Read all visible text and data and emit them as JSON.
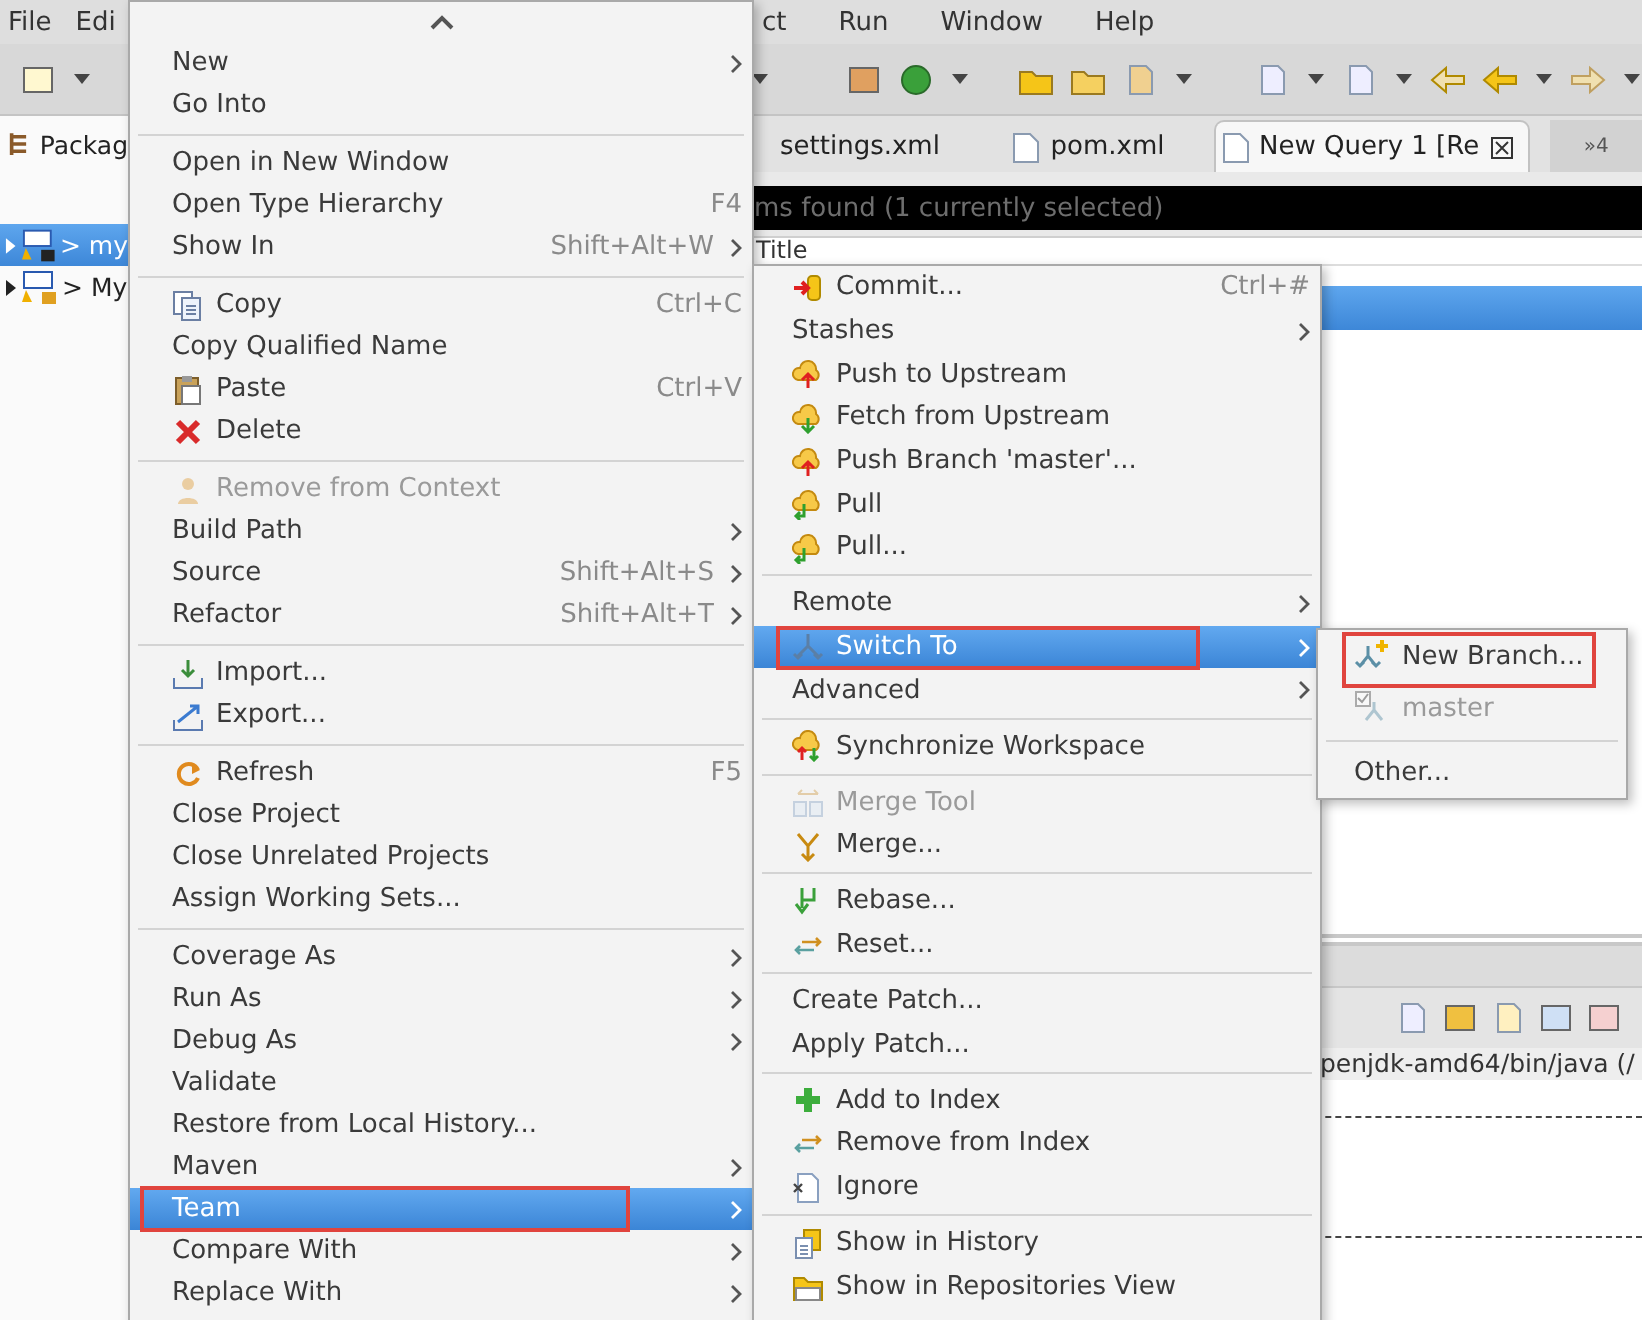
{
  "menu_bar": {
    "left": [
      "File",
      "Edi"
    ],
    "right": [
      "ct",
      "Run",
      "Window",
      "Help"
    ]
  },
  "package_explorer": {
    "tab": "Packag",
    "tree": [
      {
        "label": "> my",
        "selected": true
      },
      {
        "label": "> My",
        "selected": false
      }
    ]
  },
  "editor_tabs": [
    {
      "label": "settings.xml",
      "selected": false
    },
    {
      "label": "pom.xml",
      "selected": false
    },
    {
      "label": "New Query 1 [Re",
      "selected": true
    }
  ],
  "tab_overflow": "»4",
  "results_bar": "ms found (1 currently selected)",
  "table": {
    "column": "Title",
    "row_selected": true
  },
  "console_path": "penjdk-amd64/bin/java (/",
  "context_menu": [
    {
      "kind": "plain",
      "label": "New",
      "submenu": true,
      "selected": false,
      "disabled": false,
      "outlined": false
    },
    {
      "kind": "plain",
      "label": "Go Into",
      "selected": false,
      "disabled": false,
      "outlined": false
    },
    {
      "kind": "separator"
    },
    {
      "kind": "plain",
      "label": "Open in New Window",
      "selected": false,
      "disabled": false,
      "outlined": false
    },
    {
      "kind": "plain",
      "label": "Open Type Hierarchy",
      "shortcut": "F4",
      "selected": false,
      "disabled": false,
      "outlined": false
    },
    {
      "kind": "plain",
      "label": "Show In",
      "shortcut": "Shift+Alt+W",
      "submenu": true,
      "selected": false,
      "disabled": false,
      "outlined": false
    },
    {
      "kind": "separator"
    },
    {
      "kind": "icon",
      "label": "Copy",
      "shortcut": "Ctrl+C",
      "selected": false,
      "disabled": false,
      "outlined": false
    },
    {
      "kind": "plain",
      "label": "Copy Qualified Name",
      "selected": false,
      "disabled": false,
      "outlined": false
    },
    {
      "kind": "icon",
      "label": "Paste",
      "shortcut": "Ctrl+V",
      "selected": false,
      "disabled": false,
      "outlined": false
    },
    {
      "kind": "icon",
      "label": "Delete",
      "selected": false,
      "disabled": false,
      "outlined": false
    },
    {
      "kind": "separator"
    },
    {
      "kind": "icon",
      "label": "Remove from Context",
      "selected": false,
      "disabled": true,
      "outlined": false
    },
    {
      "kind": "plain",
      "label": "Build Path",
      "submenu": true,
      "selected": false,
      "disabled": false,
      "outlined": false
    },
    {
      "kind": "plain",
      "label": "Source",
      "shortcut": "Shift+Alt+S",
      "submenu": true,
      "selected": false,
      "disabled": false,
      "outlined": false
    },
    {
      "kind": "plain",
      "label": "Refactor",
      "shortcut": "Shift+Alt+T",
      "submenu": true,
      "selected": false,
      "disabled": false,
      "outlined": false
    },
    {
      "kind": "separator"
    },
    {
      "kind": "icon",
      "label": "Import...",
      "selected": false,
      "disabled": false,
      "outlined": false
    },
    {
      "kind": "icon",
      "label": "Export...",
      "selected": false,
      "disabled": false,
      "outlined": false
    },
    {
      "kind": "separator"
    },
    {
      "kind": "icon",
      "label": "Refresh",
      "shortcut": "F5",
      "selected": false,
      "disabled": false,
      "outlined": false
    },
    {
      "kind": "plain",
      "label": "Close Project",
      "selected": false,
      "disabled": false,
      "outlined": false
    },
    {
      "kind": "plain",
      "label": "Close Unrelated Projects",
      "selected": false,
      "disabled": false,
      "outlined": false
    },
    {
      "kind": "plain",
      "label": "Assign Working Sets...",
      "selected": false,
      "disabled": false,
      "outlined": false
    },
    {
      "kind": "separator"
    },
    {
      "kind": "plain",
      "label": "Coverage As",
      "submenu": true,
      "selected": false,
      "disabled": false,
      "outlined": false
    },
    {
      "kind": "plain",
      "label": "Run As",
      "submenu": true,
      "selected": false,
      "disabled": false,
      "outlined": false
    },
    {
      "kind": "plain",
      "label": "Debug As",
      "submenu": true,
      "selected": false,
      "disabled": false,
      "outlined": false
    },
    {
      "kind": "plain",
      "label": "Validate",
      "selected": false,
      "disabled": false,
      "outlined": false
    },
    {
      "kind": "plain",
      "label": "Restore from Local History...",
      "selected": false,
      "disabled": false,
      "outlined": false
    },
    {
      "kind": "plain",
      "label": "Maven",
      "submenu": true,
      "selected": false,
      "disabled": false,
      "outlined": false
    },
    {
      "kind": "plain",
      "label": "Team",
      "submenu": true,
      "selected": true,
      "disabled": false,
      "outlined": true
    },
    {
      "kind": "plain",
      "label": "Compare With",
      "submenu": true,
      "selected": false,
      "disabled": false,
      "outlined": false
    },
    {
      "kind": "plain",
      "label": "Replace With",
      "submenu": true,
      "selected": false,
      "disabled": false,
      "outlined": false
    }
  ],
  "team_menu": [
    {
      "kind": "icon",
      "label": "Commit...",
      "shortcut": "Ctrl+#",
      "selected": false,
      "disabled": false,
      "outlined": false
    },
    {
      "kind": "plain",
      "label": "Stashes",
      "submenu": true,
      "selected": false,
      "disabled": false,
      "outlined": false
    },
    {
      "kind": "icon",
      "label": "Push to Upstream",
      "selected": false,
      "disabled": false,
      "outlined": false
    },
    {
      "kind": "icon",
      "label": "Fetch from Upstream",
      "selected": false,
      "disabled": false,
      "outlined": false
    },
    {
      "kind": "icon",
      "label": "Push Branch 'master'...",
      "selected": false,
      "disabled": false,
      "outlined": false
    },
    {
      "kind": "icon",
      "label": "Pull",
      "selected": false,
      "disabled": false,
      "outlined": false
    },
    {
      "kind": "icon",
      "label": "Pull...",
      "selected": false,
      "disabled": false,
      "outlined": false
    },
    {
      "kind": "separator"
    },
    {
      "kind": "plain",
      "label": "Remote",
      "submenu": true,
      "selected": false,
      "disabled": false,
      "outlined": false
    },
    {
      "kind": "icon",
      "label": "Switch To",
      "submenu": true,
      "selected": true,
      "disabled": false,
      "outlined": true
    },
    {
      "kind": "plain",
      "label": "Advanced",
      "submenu": true,
      "selected": false,
      "disabled": false,
      "outlined": false
    },
    {
      "kind": "separator"
    },
    {
      "kind": "icon",
      "label": "Synchronize Workspace",
      "selected": false,
      "disabled": false,
      "outlined": false
    },
    {
      "kind": "separator"
    },
    {
      "kind": "icon",
      "label": "Merge Tool",
      "selected": false,
      "disabled": true,
      "outlined": false
    },
    {
      "kind": "icon",
      "label": "Merge...",
      "selected": false,
      "disabled": false,
      "outlined": false
    },
    {
      "kind": "separator"
    },
    {
      "kind": "icon",
      "label": "Rebase...",
      "selected": false,
      "disabled": false,
      "outlined": false
    },
    {
      "kind": "icon",
      "label": "Reset...",
      "selected": false,
      "disabled": false,
      "outlined": false
    },
    {
      "kind": "separator"
    },
    {
      "kind": "plain",
      "label": "Create Patch...",
      "selected": false,
      "disabled": false,
      "outlined": false
    },
    {
      "kind": "plain",
      "label": "Apply Patch...",
      "selected": false,
      "disabled": false,
      "outlined": false
    },
    {
      "kind": "separator"
    },
    {
      "kind": "icon",
      "label": "Add to Index",
      "selected": false,
      "disabled": false,
      "outlined": false
    },
    {
      "kind": "icon",
      "label": "Remove from Index",
      "selected": false,
      "disabled": false,
      "outlined": false
    },
    {
      "kind": "icon",
      "label": "Ignore",
      "selected": false,
      "disabled": false,
      "outlined": false
    },
    {
      "kind": "separator"
    },
    {
      "kind": "icon",
      "label": "Show in History",
      "selected": false,
      "disabled": false,
      "outlined": false
    },
    {
      "kind": "icon",
      "label": "Show in Repositories View",
      "selected": false,
      "disabled": false,
      "outlined": false
    }
  ],
  "switch_to_menu": [
    {
      "kind": "icon",
      "label": "New Branch...",
      "selected": false,
      "disabled": false,
      "outlined": true
    },
    {
      "kind": "icon",
      "label": "master",
      "selected": false,
      "disabled": true,
      "outlined": false
    },
    {
      "kind": "separator"
    },
    {
      "kind": "plain",
      "label": "Other...",
      "selected": false,
      "disabled": false,
      "outlined": false
    }
  ]
}
